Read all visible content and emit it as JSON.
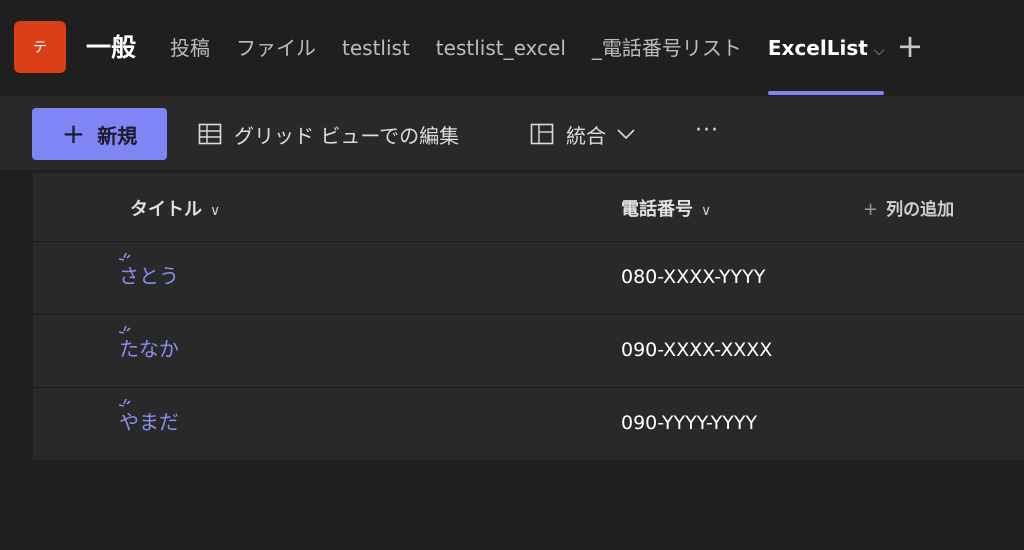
{
  "team": {
    "avatar_letter": "テ",
    "color": "#dc3e15"
  },
  "channel": {
    "title": "一般"
  },
  "tabs": [
    {
      "label": "投稿",
      "active": false
    },
    {
      "label": "ファイル",
      "active": false
    },
    {
      "label": "testlist",
      "active": false
    },
    {
      "label": "testlist_excel",
      "active": false
    },
    {
      "label": "_電話番号リスト",
      "active": false
    },
    {
      "label": "ExcelList",
      "active": true,
      "icon": "chevron-down-icon"
    }
  ],
  "add_tab_icon": "plus-icon",
  "toolbar": {
    "new_label": "新規",
    "grid_edit_label": "グリッド ビューでの編集",
    "integrate_label": "統合",
    "more_label": "···"
  },
  "list": {
    "columns": {
      "title": "タイトル",
      "phone": "電話番号",
      "add_column": "列の追加"
    },
    "rows": [
      {
        "title": "さとう",
        "phone": "080-XXXX-YYYY"
      },
      {
        "title": "たなか",
        "phone": "090-XXXX-XXXX"
      },
      {
        "title": "やまだ",
        "phone": "090-YYYY-YYYY"
      }
    ]
  },
  "colors": {
    "accent": "#7f85f5",
    "background": "#1f1f1f",
    "panel": "#292929"
  }
}
